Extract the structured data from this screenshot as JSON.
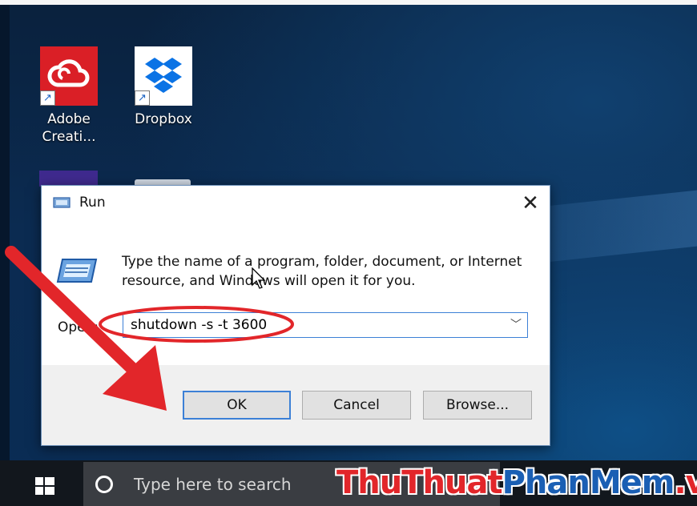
{
  "desktop": {
    "icons": [
      {
        "label": "Adobe\nCreati...",
        "icon": "adobe-creative-cloud-icon"
      },
      {
        "label": "Dropbox",
        "icon": "dropbox-icon"
      }
    ]
  },
  "dialog": {
    "title": "Run",
    "description": "Type the name of a program, folder, document, or Internet resource, and Windows will open it for you.",
    "open_label": "Open:",
    "command_value": "shutdown -s -t 3600",
    "buttons": {
      "ok": "OK",
      "cancel": "Cancel",
      "browse": "Browse..."
    }
  },
  "taskbar": {
    "search_placeholder": "Type here to search"
  },
  "watermark": {
    "part1": "ThuThuat",
    "part2": "PhanMem",
    "part3": ".vn"
  },
  "colors": {
    "annotation_red": "#e2262a",
    "accent_blue": "#3c80d6"
  }
}
